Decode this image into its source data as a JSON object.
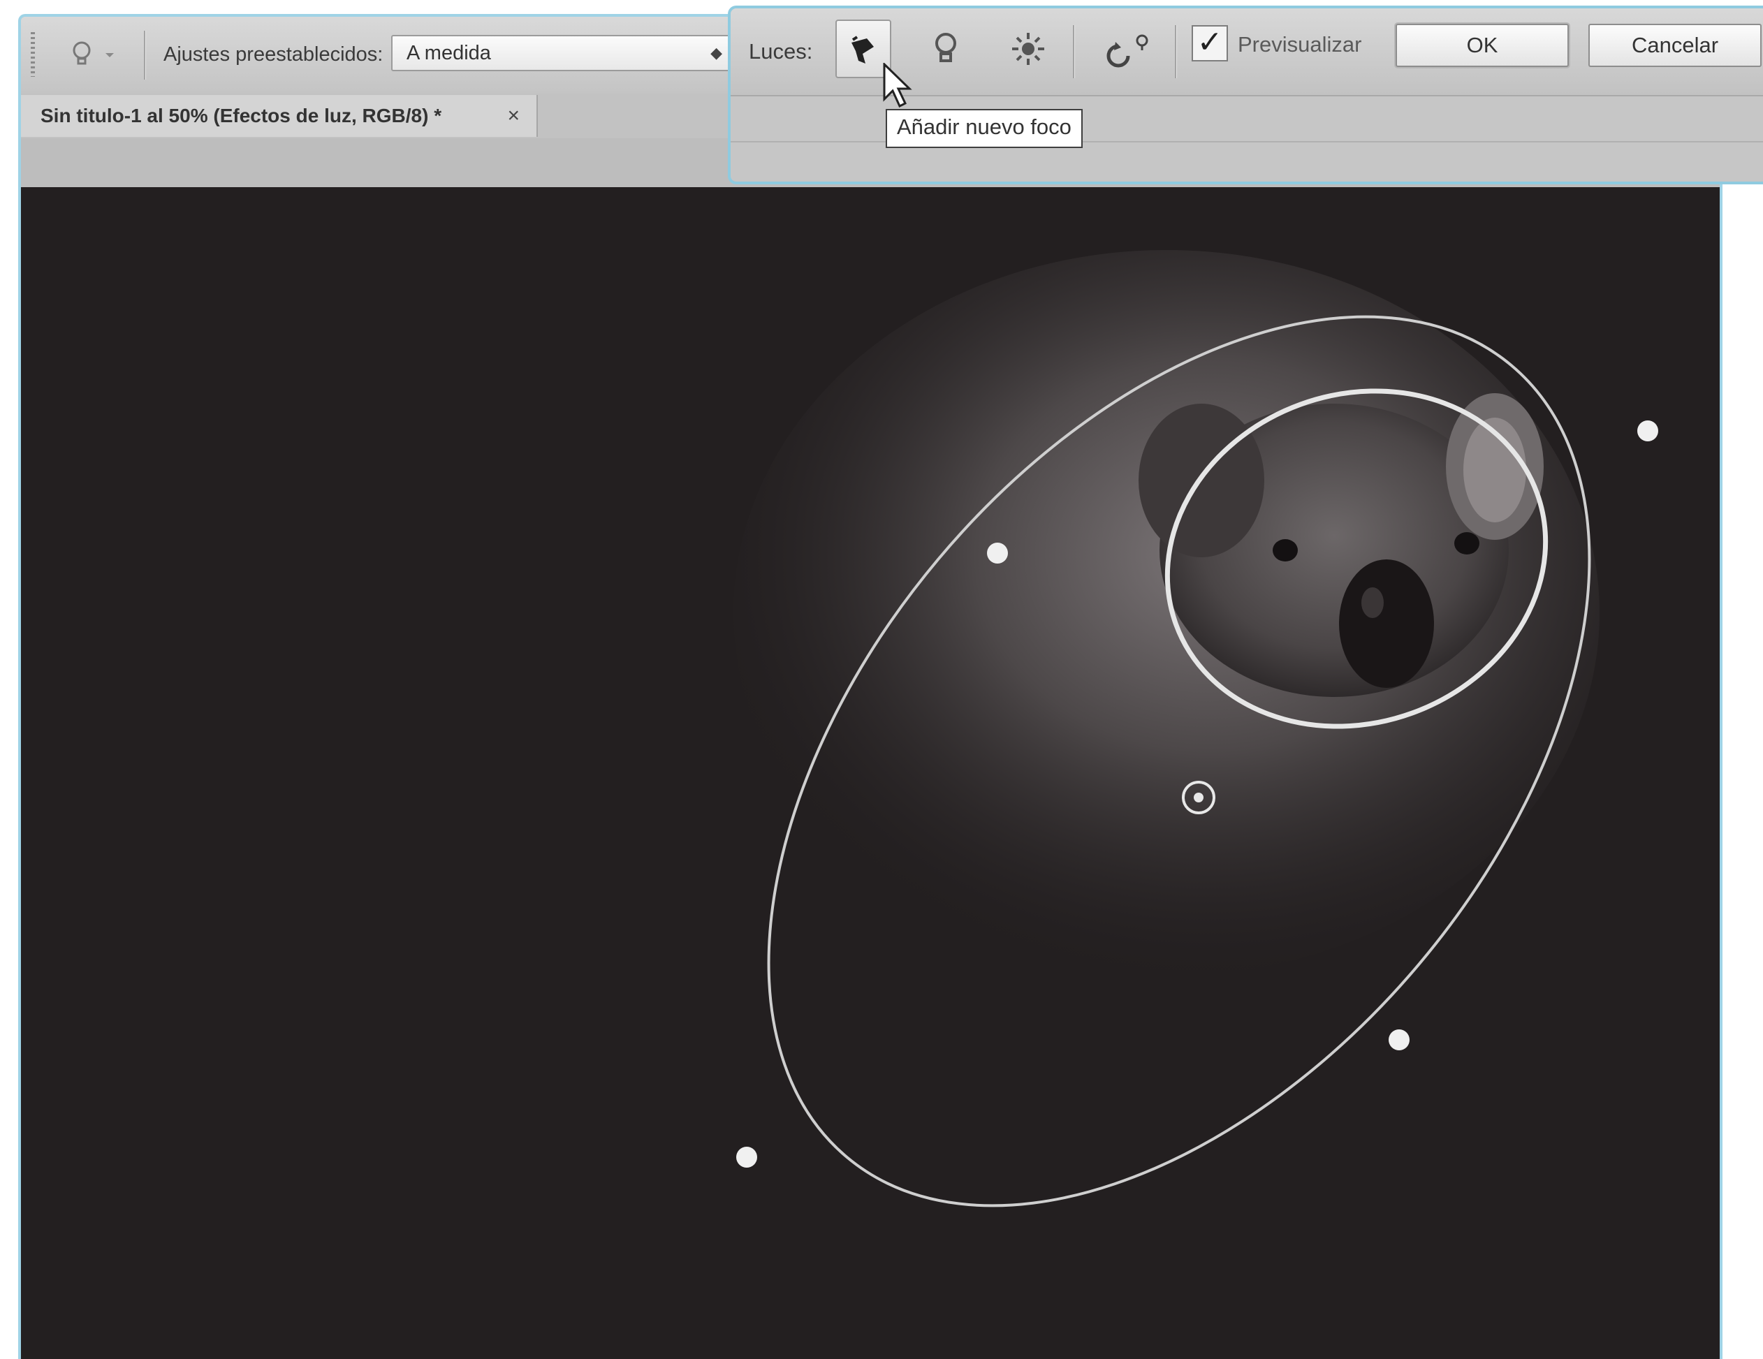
{
  "options_bar": {
    "icon": "lightbulb-icon",
    "dropdown_icon": "chevron-down-icon",
    "presets_label": "Ajustes preestablecidos:",
    "preset_value": "A medida"
  },
  "document_tab": {
    "title": "Sin titulo-1 al 50% (Efectos de luz, RGB/8) *",
    "close_label": "×"
  },
  "lights_toolbar": {
    "label": "Luces:",
    "spot_icon": "add-spot-light-icon",
    "point_icon": "add-point-light-icon",
    "infinite_icon": "add-infinite-light-icon",
    "reset_icon": "reset-lights-icon",
    "preview_label": "Previsualizar",
    "preview_checked": true,
    "ok_label": "OK",
    "cancel_label": "Cancelar"
  },
  "tooltip": {
    "text": "Añadir nuevo foco"
  },
  "colors": {
    "canvas": "#231f20",
    "frame_accent": "#9fd3e6",
    "light_outline": "#d8d8d8"
  }
}
